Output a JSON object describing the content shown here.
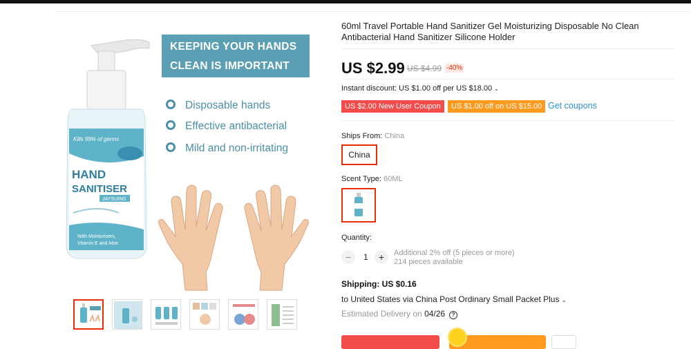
{
  "product": {
    "title": "60ml Travel Portable Hand Sanitizer Gel Moisturizing Disposable No Clean Antibacterial Hand Sanitizer Silicone Holder",
    "price": "US $2.99",
    "original_price": "US $4.99",
    "discount": "-40%",
    "instant_discount": "Instant discount: US $1.00 off per US $18.00",
    "coupons": [
      "US $2.00 New User Coupon",
      "US $1.00 off on US $15.00"
    ],
    "get_coupons": "Get coupons"
  },
  "image": {
    "banner_line1": "KEEPING YOUR HANDS",
    "banner_line2": "CLEAN IS IMPORTANT",
    "features": [
      "Disposable hands",
      "Effective antibacterial",
      "Mild and non-irritating"
    ],
    "bottle_tag": "Kills 99% of germs",
    "bottle_name1": "HAND",
    "bottle_name2": "SANITISER",
    "bottle_brand": "JAYSUING",
    "bottle_small1": "With Moisturisers,",
    "bottle_small2": "Vitamin E and Aloe"
  },
  "ships_from": {
    "label": "Ships From:",
    "value": "China",
    "option": "China"
  },
  "scent": {
    "label": "Scent Type:",
    "value": "60ML"
  },
  "quantity": {
    "label": "Quantity:",
    "minus": "−",
    "value": "1",
    "plus": "+",
    "additional": "Additional 2% off (5 pieces or more)",
    "available": "214 pieces available"
  },
  "shipping": {
    "title": "Shipping: US $0.16",
    "route": "to United States via China Post Ordinary Small Packet Plus",
    "delivery_label": "Estimated Delivery on",
    "delivery_date": "04/26",
    "help": "?"
  },
  "colors": {
    "accent": "#e62e04",
    "coupon_red": "#f44b4b",
    "coupon_orange": "#ff9a1f",
    "link": "#2e8fd3",
    "image_teal": "#5a9fb3"
  }
}
